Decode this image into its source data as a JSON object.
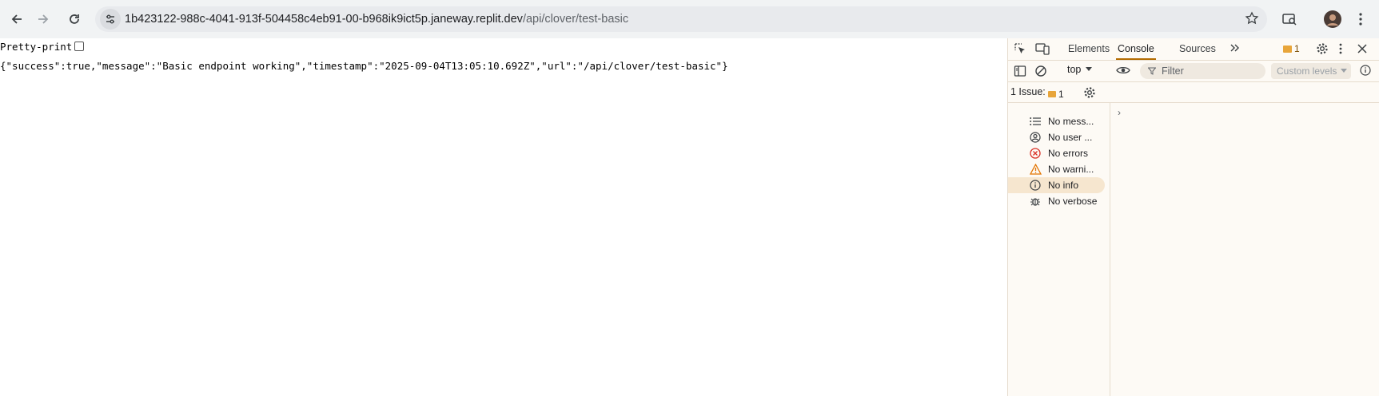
{
  "browser": {
    "url_host": "1b423122-988c-4041-913f-504458c4eb91-00-b968ik9ict5p.janeway.replit.dev",
    "url_path": "/api/clover/test-basic"
  },
  "page": {
    "pretty_print_label": "Pretty-print",
    "json_text": "{\"success\":true,\"message\":\"Basic endpoint working\",\"timestamp\":\"2025-09-04T13:05:10.692Z\",\"url\":\"/api/clover/test-basic\"}"
  },
  "devtools": {
    "tabs": {
      "elements": "Elements",
      "console": "Console",
      "sources": "Sources"
    },
    "issue_badge_count": "1",
    "console_bar": {
      "context": "top",
      "filter_placeholder": "Filter",
      "levels": "Custom levels"
    },
    "issues_bar": {
      "label": "1 Issue:",
      "count": "1"
    },
    "sidebar": [
      {
        "label": "No mess...",
        "icon": "list-icon"
      },
      {
        "label": "No user ...",
        "icon": "user-icon"
      },
      {
        "label": "No errors",
        "icon": "error-icon"
      },
      {
        "label": "No warni...",
        "icon": "warning-icon"
      },
      {
        "label": "No info",
        "icon": "info-icon"
      },
      {
        "label": "No verbose",
        "icon": "bug-icon"
      }
    ],
    "colors": {
      "accent": "#b36b00",
      "error": "#d93025",
      "warning": "#e37400",
      "selected": "#f6e6cf"
    }
  }
}
